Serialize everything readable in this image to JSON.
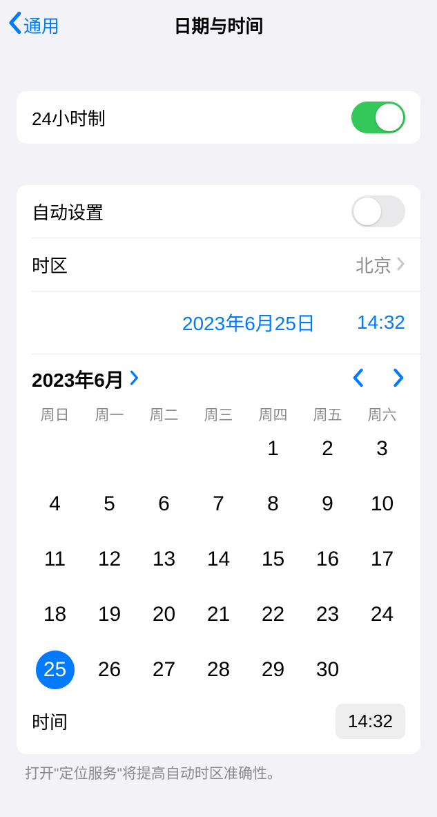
{
  "header": {
    "back_label": "通用",
    "title": "日期与时间"
  },
  "settings": {
    "hour24_label": "24小时制",
    "hour24_on": true,
    "autoset_label": "自动设置",
    "autoset_on": false,
    "timezone_label": "时区",
    "timezone_value": "北京"
  },
  "summary": {
    "date_text": "2023年6月25日",
    "time_text": "14:32"
  },
  "calendar": {
    "month_label": "2023年6月",
    "weekdays": [
      "周日",
      "周一",
      "周二",
      "周三",
      "周四",
      "周五",
      "周六"
    ],
    "days": [
      {
        "n": "",
        "blank": true
      },
      {
        "n": "",
        "blank": true
      },
      {
        "n": "",
        "blank": true
      },
      {
        "n": "",
        "blank": true
      },
      {
        "n": "1"
      },
      {
        "n": "2"
      },
      {
        "n": "3"
      },
      {
        "n": "4"
      },
      {
        "n": "5"
      },
      {
        "n": "6"
      },
      {
        "n": "7"
      },
      {
        "n": "8"
      },
      {
        "n": "9"
      },
      {
        "n": "10"
      },
      {
        "n": "11"
      },
      {
        "n": "12"
      },
      {
        "n": "13"
      },
      {
        "n": "14"
      },
      {
        "n": "15"
      },
      {
        "n": "16"
      },
      {
        "n": "17"
      },
      {
        "n": "18"
      },
      {
        "n": "19"
      },
      {
        "n": "20"
      },
      {
        "n": "21"
      },
      {
        "n": "22"
      },
      {
        "n": "23"
      },
      {
        "n": "24"
      },
      {
        "n": "25",
        "selected": true
      },
      {
        "n": "26"
      },
      {
        "n": "27"
      },
      {
        "n": "28"
      },
      {
        "n": "29"
      },
      {
        "n": "30"
      }
    ],
    "time_label": "时间",
    "time_value": "14:32"
  },
  "footnote": "打开\"定位服务\"将提高自动时区准确性。"
}
